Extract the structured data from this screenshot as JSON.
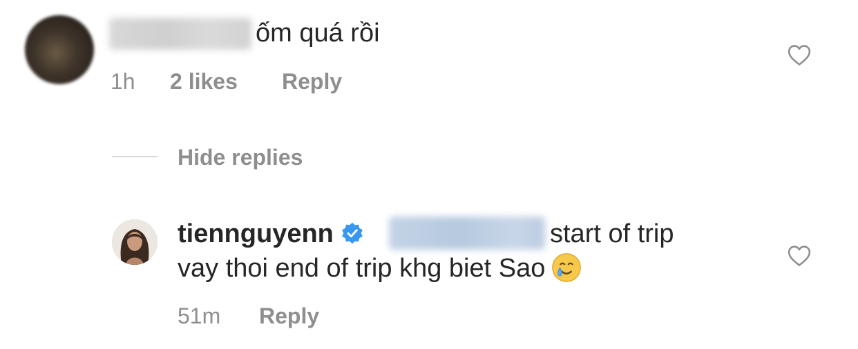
{
  "comment": {
    "text": "ốm quá rồi",
    "time": "1h",
    "likes": "2 likes",
    "reply_label": "Reply"
  },
  "replies_toggle": {
    "label": "Hide replies"
  },
  "reply": {
    "username": "tiennguyenn",
    "text_line1": "start of trip",
    "text_line2": "vay thoi end of trip khg biet Sao",
    "emoji": "🥲",
    "time": "51m",
    "reply_label": "Reply"
  },
  "icons": {
    "like": "heart-outline-icon",
    "verified": "verified-badge-icon"
  },
  "colors": {
    "primary_text": "#262626",
    "secondary_text": "#8e8e8e",
    "verified_blue": "#3897f0",
    "heart_stroke": "#8e8e8e"
  }
}
